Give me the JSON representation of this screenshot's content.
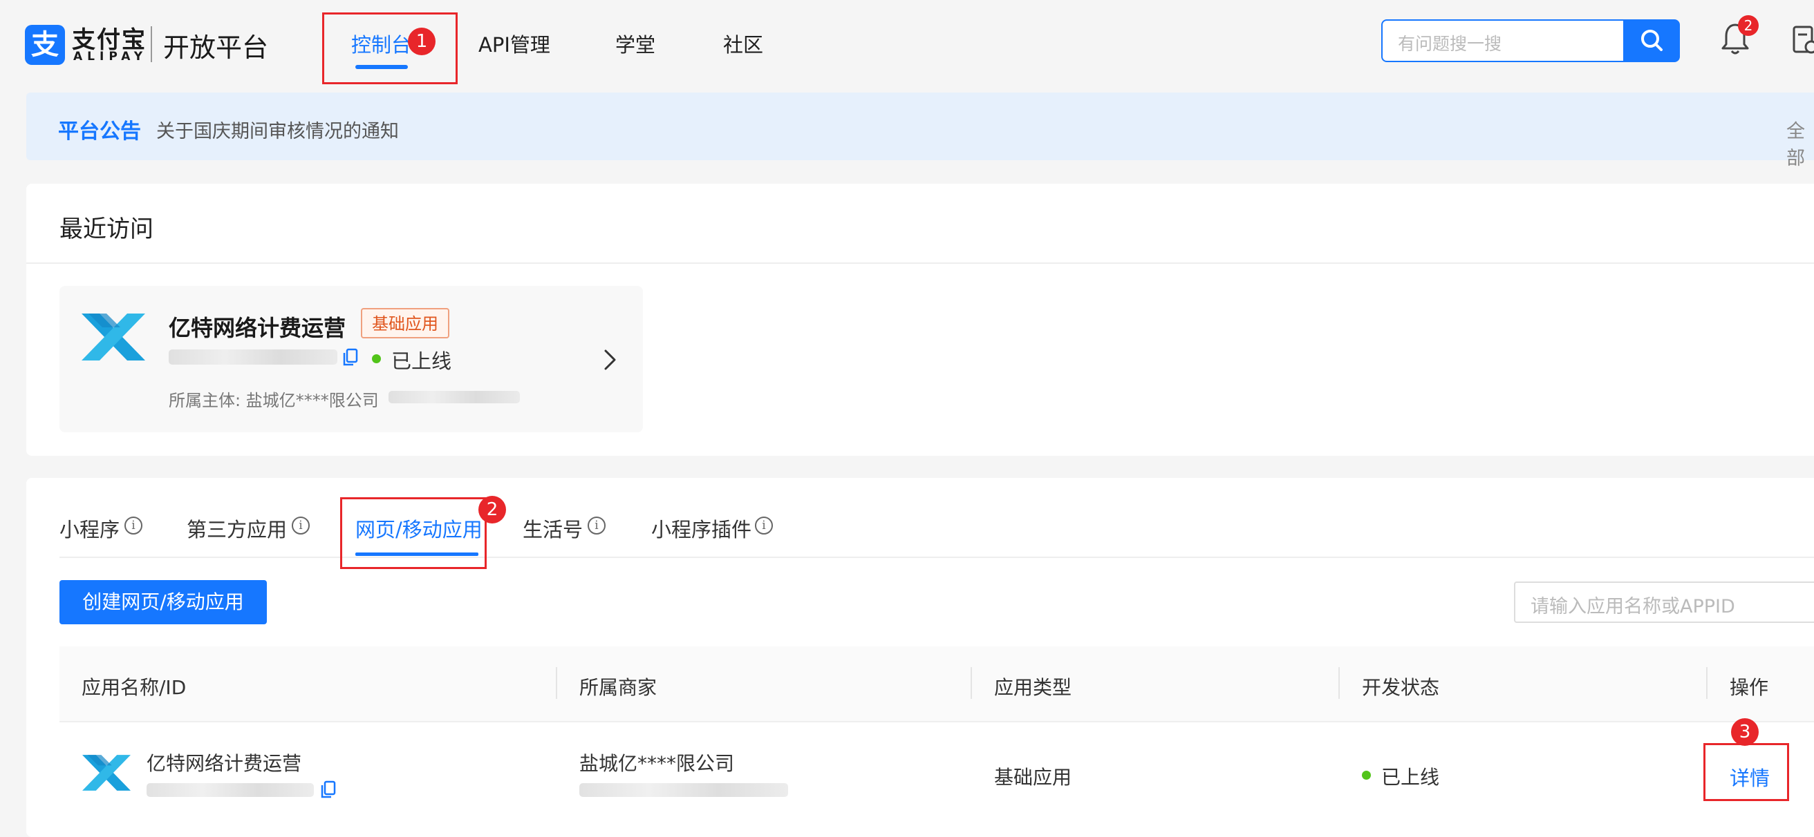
{
  "header": {
    "logo_text": "支付宝",
    "logo_sub": "ALIPAY",
    "platform": "开放平台",
    "nav": [
      "控制台",
      "API管理",
      "学堂",
      "社区"
    ],
    "search_placeholder": "有问题搜一搜",
    "notification_count": "2"
  },
  "annotations": [
    "1",
    "2",
    "3"
  ],
  "notice": {
    "title": "平台公告",
    "text": "关于国庆期间审核情况的通知",
    "all": "全部"
  },
  "recent": {
    "title": "最近访问",
    "app_name": "亿特网络计费运营",
    "tag": "基础应用",
    "status": "已上线",
    "owner": "所属主体: 盐城亿****限公司"
  },
  "tabs": [
    "小程序",
    "第三方应用",
    "网页/移动应用",
    "生活号",
    "小程序插件"
  ],
  "create_button": "创建网页/移动应用",
  "app_search_placeholder": "请输入应用名称或APPID",
  "table": {
    "headers": [
      "应用名称/ID",
      "所属商家",
      "应用类型",
      "开发状态",
      "操作"
    ],
    "rows": [
      {
        "name": "亿特网络计费运营",
        "merchant": "盐城亿****限公司",
        "type": "基础应用",
        "status": "已上线",
        "action": "详情"
      }
    ]
  },
  "colors": {
    "primary": "#1677ff",
    "annotation_red": "#e8262a",
    "online_green": "#52c41a",
    "tag_orange": "#e0561e"
  }
}
